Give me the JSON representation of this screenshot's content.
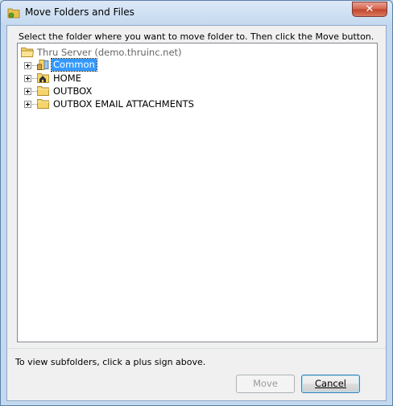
{
  "window": {
    "title": "Move Folders and Files",
    "close_label": "✕"
  },
  "instruction": "Select the folder where you want to move folder to. Then click the Move button.",
  "tree": {
    "root": {
      "label": "Thru Server (demo.thruinc.net)",
      "icon": "folder-open-icon"
    },
    "items": [
      {
        "label": "Common",
        "icon": "shared-folder-icon",
        "selected": true
      },
      {
        "label": "HOME",
        "icon": "home-folder-icon",
        "selected": false
      },
      {
        "label": "OUTBOX",
        "icon": "folder-icon",
        "selected": false
      },
      {
        "label": "OUTBOX EMAIL ATTACHMENTS",
        "icon": "folder-icon",
        "selected": false
      }
    ]
  },
  "hint": "To view subfolders, click a plus sign above.",
  "buttons": {
    "move": {
      "label": "Move",
      "enabled": false
    },
    "cancel": {
      "label": "Cancel",
      "enabled": true
    }
  },
  "colors": {
    "selection": "#3399ff",
    "folder": "#f5d46a"
  }
}
